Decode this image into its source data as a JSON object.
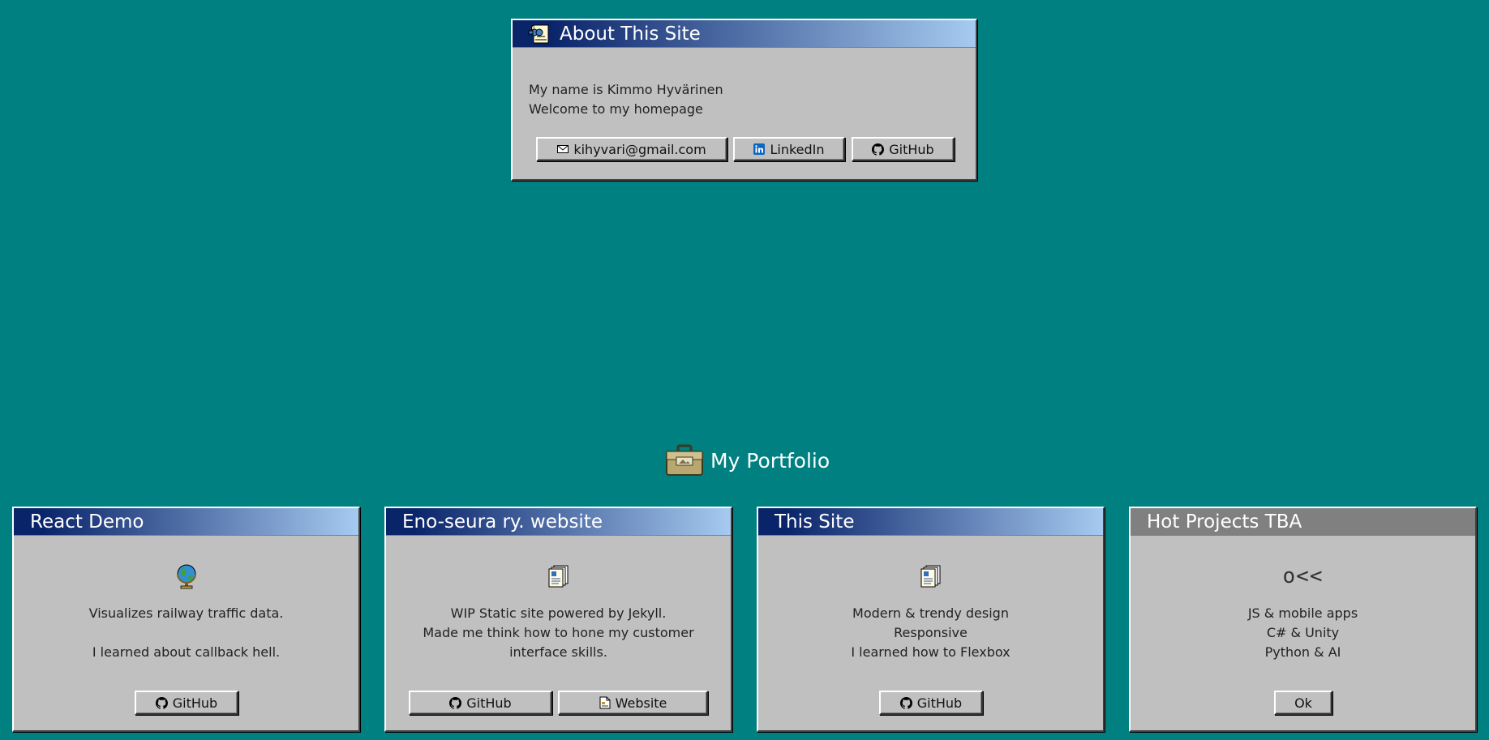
{
  "about": {
    "title": "About This Site",
    "line1": "My name is Kimmo Hyvärinen",
    "line2": "Welcome to my homepage",
    "buttons": {
      "email": "kihyvari@gmail.com",
      "linkedin": "LinkedIn",
      "github": "GitHub"
    }
  },
  "portfolio": {
    "heading": "My Portfolio",
    "cards": [
      {
        "title": "React Demo",
        "icon": "globe-icon",
        "lines": [
          "Visualizes railway traffic data.",
          "",
          "I learned about callback hell."
        ],
        "buttons": [
          "GitHub"
        ]
      },
      {
        "title": "Eno-seura ry. website",
        "icon": "document-icon",
        "lines": [
          "WIP Static site powered by Jekyll.",
          "Made me think how to hone my customer",
          "interface skills."
        ],
        "buttons": [
          "GitHub",
          "Website"
        ]
      },
      {
        "title": "This Site",
        "icon": "document-icon",
        "lines": [
          "Modern & trendy design",
          "Responsive",
          "I learned how to Flexbox"
        ],
        "buttons": [
          "GitHub"
        ]
      },
      {
        "title": "Hot Projects TBA",
        "icon": "fish-ascii-icon",
        "icon_text": "o<<",
        "lines": [
          "JS & mobile apps",
          "C# & Unity",
          "Python & AI"
        ],
        "buttons": [
          "Ok"
        ]
      }
    ]
  },
  "colors": {
    "desktop": "#008080",
    "window": "#c0c0c0",
    "title_active_start": "#0a246a",
    "title_active_end": "#a6caf0",
    "title_inactive": "#808080"
  }
}
